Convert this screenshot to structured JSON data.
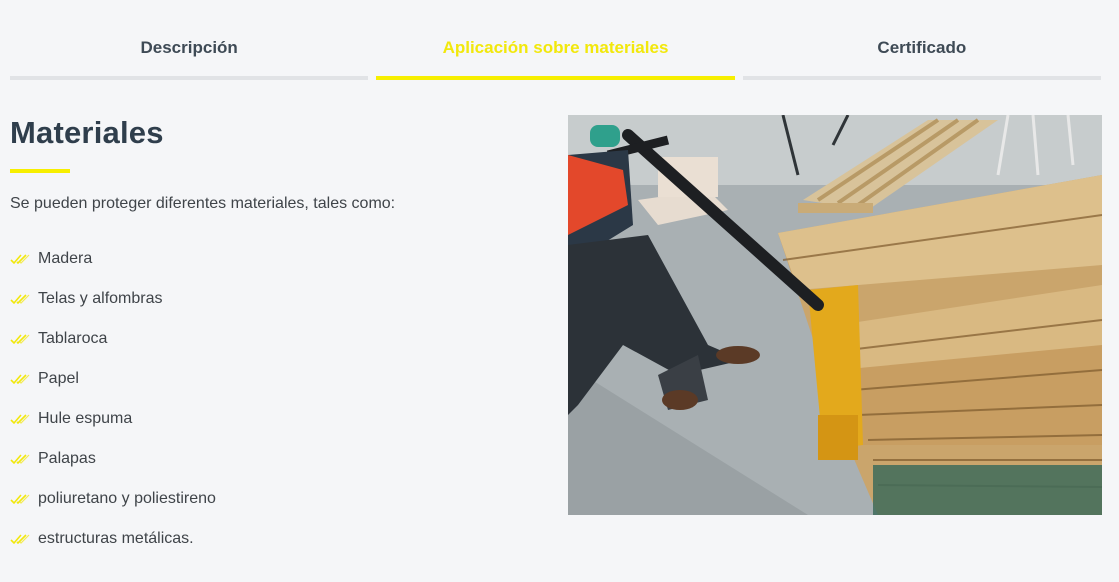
{
  "tabs": [
    {
      "label": "Descripción",
      "active": false
    },
    {
      "label": "Aplicación sobre materiales",
      "active": true
    },
    {
      "label": "Certificado",
      "active": false
    }
  ],
  "content": {
    "heading": "Materiales",
    "intro": "Se pueden proteger diferentes materiales, tales como:",
    "items": [
      "Madera",
      "Telas y alfombras",
      "Tablaroca",
      "Papel",
      "Hule espuma",
      "Palapas",
      "poliuretano y poliestireno",
      "estructuras metálicas."
    ]
  },
  "colors": {
    "accent": "#f7ef00",
    "heading": "#2f3e4c",
    "background": "#f5f6f8"
  },
  "icons": {
    "list_bullet": "double-check-icon"
  }
}
